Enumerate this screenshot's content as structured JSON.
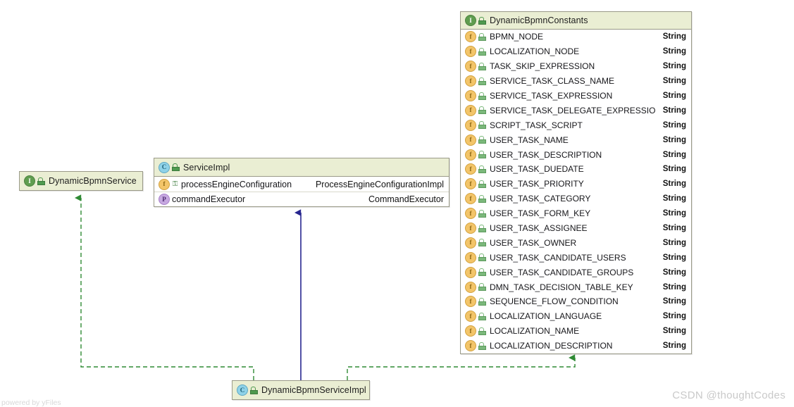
{
  "diagram": {
    "tool_credit": "powered by yFiles",
    "watermark": "CSDN @thoughtCodes",
    "colors": {
      "header_fill": "#eaeed3",
      "node_border": "#9a9a88",
      "realization_edge": "#2f8a34",
      "generalization_edge": "#27268f",
      "interface_icon": "#5f9d4f",
      "class_icon": "#8fd2e8",
      "field_icon": "#f3c569",
      "property_icon": "#c6a8e0"
    }
  },
  "nodes": {
    "dynamic_bpmn_service": {
      "name": "DynamicBpmnService",
      "stereotype_icon": "interface-icon",
      "icon_letter": "I",
      "visibility_icon": "lock-public-icon"
    },
    "dynamic_bpmn_service_impl": {
      "name": "DynamicBpmnServiceImpl",
      "stereotype_icon": "class-icon",
      "icon_letter": "C",
      "visibility_icon": "lock-public-icon"
    },
    "service_impl": {
      "name": "ServiceImpl",
      "stereotype_icon": "class-icon",
      "icon_letter": "C",
      "visibility_icon": "lock-public-icon",
      "members": [
        {
          "icon": "field-icon",
          "icon_letter": "f",
          "visibility_icon": "protected-icon",
          "visibility_glyph": "⚿",
          "name": "processEngineConfiguration",
          "type": "ProcessEngineConfigurationImpl"
        },
        {
          "icon": "property-icon",
          "icon_letter": "P",
          "visibility_icon": "package-icon",
          "visibility_glyph": "",
          "name": "commandExecutor",
          "type": "CommandExecutor"
        }
      ]
    },
    "dynamic_bpmn_constants": {
      "name": "DynamicBpmnConstants",
      "stereotype_icon": "interface-icon",
      "icon_letter": "I",
      "visibility_icon": "lock-public-icon",
      "fields": [
        {
          "name": "BPMN_NODE",
          "type": "String"
        },
        {
          "name": "LOCALIZATION_NODE",
          "type": "String"
        },
        {
          "name": "TASK_SKIP_EXPRESSION",
          "type": "String"
        },
        {
          "name": "SERVICE_TASK_CLASS_NAME",
          "type": "String"
        },
        {
          "name": "SERVICE_TASK_EXPRESSION",
          "type": "String"
        },
        {
          "name": "SERVICE_TASK_DELEGATE_EXPRESSION",
          "type": "String"
        },
        {
          "name": "SCRIPT_TASK_SCRIPT",
          "type": "String"
        },
        {
          "name": "USER_TASK_NAME",
          "type": "String"
        },
        {
          "name": "USER_TASK_DESCRIPTION",
          "type": "String"
        },
        {
          "name": "USER_TASK_DUEDATE",
          "type": "String"
        },
        {
          "name": "USER_TASK_PRIORITY",
          "type": "String"
        },
        {
          "name": "USER_TASK_CATEGORY",
          "type": "String"
        },
        {
          "name": "USER_TASK_FORM_KEY",
          "type": "String"
        },
        {
          "name": "USER_TASK_ASSIGNEE",
          "type": "String"
        },
        {
          "name": "USER_TASK_OWNER",
          "type": "String"
        },
        {
          "name": "USER_TASK_CANDIDATE_USERS",
          "type": "String"
        },
        {
          "name": "USER_TASK_CANDIDATE_GROUPS",
          "type": "String"
        },
        {
          "name": "DMN_TASK_DECISION_TABLE_KEY",
          "type": "String"
        },
        {
          "name": "SEQUENCE_FLOW_CONDITION",
          "type": "String"
        },
        {
          "name": "LOCALIZATION_LANGUAGE",
          "type": "String"
        },
        {
          "name": "LOCALIZATION_NAME",
          "type": "String"
        },
        {
          "name": "LOCALIZATION_DESCRIPTION",
          "type": "String"
        }
      ]
    }
  },
  "edges": [
    {
      "name": "realization-impl-to-service",
      "from": "DynamicBpmnServiceImpl",
      "to": "DynamicBpmnService",
      "style": "dashed",
      "arrow": "triangle",
      "color": "#2f8a34"
    },
    {
      "name": "generalization-impl-to-serviceimpl",
      "from": "DynamicBpmnServiceImpl",
      "to": "ServiceImpl",
      "style": "solid",
      "arrow": "triangle",
      "color": "#27268f"
    },
    {
      "name": "realization-impl-to-constants",
      "from": "DynamicBpmnServiceImpl",
      "to": "DynamicBpmnConstants",
      "style": "dashed",
      "arrow": "triangle",
      "color": "#2f8a34"
    }
  ]
}
